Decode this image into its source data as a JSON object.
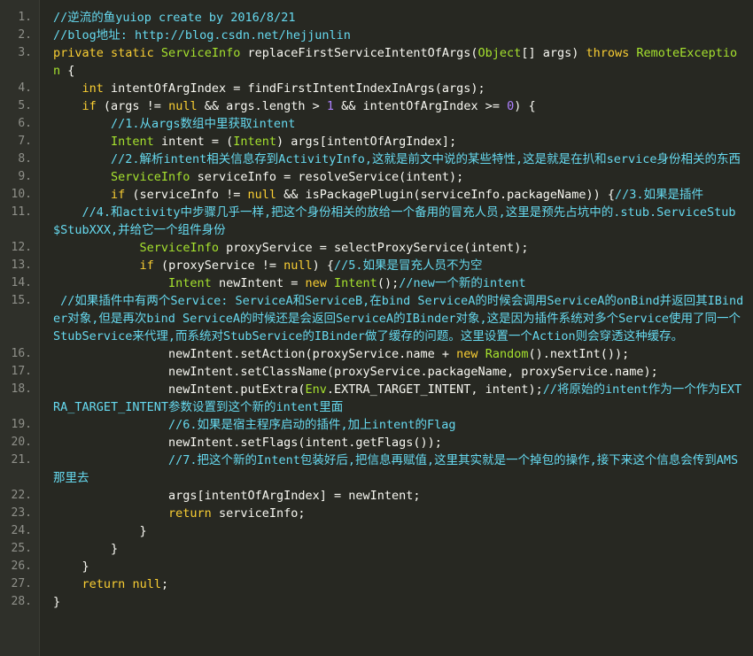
{
  "editor": {
    "lines": [
      {
        "num": "1.",
        "tokens": [
          {
            "t": "//逆流的鱼yuiop create by 2016/8/21",
            "c": "c"
          }
        ]
      },
      {
        "num": "2.",
        "tokens": [
          {
            "t": "//blog地址: http://blog.csdn.net/hejjunlin",
            "c": "c"
          }
        ]
      },
      {
        "num": "3.",
        "tokens": [
          {
            "t": "private static ",
            "c": "k"
          },
          {
            "t": "ServiceInfo",
            "c": "t"
          },
          {
            "t": " replaceFirstServiceIntentOfArgs(",
            "c": "p"
          },
          {
            "t": "Object",
            "c": "t"
          },
          {
            "t": "[] args) ",
            "c": "p"
          },
          {
            "t": "throws ",
            "c": "k"
          },
          {
            "t": "RemoteException",
            "c": "t"
          },
          {
            "t": " {",
            "c": "p"
          }
        ]
      },
      {
        "num": "4.",
        "tokens": [
          {
            "t": "    ",
            "c": "p"
          },
          {
            "t": "int",
            "c": "k"
          },
          {
            "t": " intentOfArgIndex = findFirstIntentIndexInArgs(args);",
            "c": "p"
          }
        ]
      },
      {
        "num": "5.",
        "tokens": [
          {
            "t": "    ",
            "c": "p"
          },
          {
            "t": "if",
            "c": "k"
          },
          {
            "t": " (args != ",
            "c": "p"
          },
          {
            "t": "null",
            "c": "k"
          },
          {
            "t": " && args.length > ",
            "c": "p"
          },
          {
            "t": "1",
            "c": "n"
          },
          {
            "t": " && intentOfArgIndex >= ",
            "c": "p"
          },
          {
            "t": "0",
            "c": "n"
          },
          {
            "t": ") {",
            "c": "p"
          }
        ]
      },
      {
        "num": "6.",
        "tokens": [
          {
            "t": "        ",
            "c": "p"
          },
          {
            "t": "//1.从args数组中里获取intent",
            "c": "c"
          }
        ]
      },
      {
        "num": "7.",
        "tokens": [
          {
            "t": "        ",
            "c": "p"
          },
          {
            "t": "Intent",
            "c": "t"
          },
          {
            "t": " intent = (",
            "c": "p"
          },
          {
            "t": "Intent",
            "c": "t"
          },
          {
            "t": ") args[intentOfArgIndex];",
            "c": "p"
          }
        ]
      },
      {
        "num": "8.",
        "tokens": [
          {
            "t": "        ",
            "c": "p"
          },
          {
            "t": "//2.解析intent相关信息存到ActivityInfo,这就是前文中说的某些特性,这是就是在扒和service身份相关的东西",
            "c": "c"
          }
        ]
      },
      {
        "num": "9.",
        "tokens": [
          {
            "t": "        ",
            "c": "p"
          },
          {
            "t": "ServiceInfo",
            "c": "t"
          },
          {
            "t": " serviceInfo = resolveService(intent);",
            "c": "p"
          }
        ]
      },
      {
        "num": "10.",
        "tokens": [
          {
            "t": "        ",
            "c": "p"
          },
          {
            "t": "if",
            "c": "k"
          },
          {
            "t": " (serviceInfo != ",
            "c": "p"
          },
          {
            "t": "null",
            "c": "k"
          },
          {
            "t": " && isPackagePlugin(serviceInfo.packageName)) {",
            "c": "p"
          },
          {
            "t": "//3.如果是插件",
            "c": "c"
          }
        ]
      },
      {
        "num": "11.",
        "tokens": [
          {
            "t": "    ",
            "c": "p"
          },
          {
            "t": "//4.和activity中步骤几乎一样,把这个身份相关的放给一个备用的冒充人员,这里是预先占坑中的.stub.ServiceStub$StubXXX,并给它一个组件身份",
            "c": "c"
          }
        ]
      },
      {
        "num": "12.",
        "tokens": [
          {
            "t": "            ",
            "c": "p"
          },
          {
            "t": "ServiceInfo",
            "c": "t"
          },
          {
            "t": " proxyService = selectProxyService(intent);",
            "c": "p"
          }
        ]
      },
      {
        "num": "13.",
        "tokens": [
          {
            "t": "            ",
            "c": "p"
          },
          {
            "t": "if",
            "c": "k"
          },
          {
            "t": " (proxyService != ",
            "c": "p"
          },
          {
            "t": "null",
            "c": "k"
          },
          {
            "t": ") {",
            "c": "p"
          },
          {
            "t": "//5.如果是冒充人员不为空",
            "c": "c"
          }
        ]
      },
      {
        "num": "14.",
        "tokens": [
          {
            "t": "                ",
            "c": "p"
          },
          {
            "t": "Intent",
            "c": "t"
          },
          {
            "t": " newIntent = ",
            "c": "p"
          },
          {
            "t": "new",
            "c": "k"
          },
          {
            "t": " ",
            "c": "p"
          },
          {
            "t": "Intent",
            "c": "t"
          },
          {
            "t": "();",
            "c": "p"
          },
          {
            "t": "//new一个新的intent",
            "c": "c"
          }
        ]
      },
      {
        "num": "15.",
        "tokens": [
          {
            "t": " //如果插件中有两个Service: ServiceA和ServiceB,在bind ServiceA的时候会调用ServiceA的onBind并返回其IBinder对象,但是再次bind ServiceA的时候还是会返回ServiceA的IBinder对象,这是因为插件系统对多个Service使用了同一个StubService来代理,而系统对StubService的IBinder做了缓存的问题。这里设置一个Action则会穿透这种缓存。",
            "c": "c"
          }
        ]
      },
      {
        "num": "16.",
        "tokens": [
          {
            "t": "                ",
            "c": "p"
          },
          {
            "t": "newIntent.setAction(proxyService.name + ",
            "c": "p"
          },
          {
            "t": "new",
            "c": "k"
          },
          {
            "t": " ",
            "c": "p"
          },
          {
            "t": "Random",
            "c": "t"
          },
          {
            "t": "().nextInt());",
            "c": "p"
          }
        ]
      },
      {
        "num": "17.",
        "tokens": [
          {
            "t": "                ",
            "c": "p"
          },
          {
            "t": "newIntent.setClassName(proxyService.packageName, proxyService.name);",
            "c": "p"
          }
        ]
      },
      {
        "num": "18.",
        "tokens": [
          {
            "t": "                ",
            "c": "p"
          },
          {
            "t": "newIntent.putExtra(",
            "c": "p"
          },
          {
            "t": "Env",
            "c": "t"
          },
          {
            "t": ".EXTRA_TARGET_INTENT, intent);",
            "c": "p"
          },
          {
            "t": "//将原始的intent作为一个作为EXTRA_TARGET_INTENT参数设置到这个新的intent里面",
            "c": "c"
          }
        ]
      },
      {
        "num": "19.",
        "tokens": [
          {
            "t": "                ",
            "c": "p"
          },
          {
            "t": "//6.如果是宿主程序启动的插件,加上intent的Flag",
            "c": "c"
          }
        ]
      },
      {
        "num": "20.",
        "tokens": [
          {
            "t": "                ",
            "c": "p"
          },
          {
            "t": "newIntent.setFlags(intent.getFlags());",
            "c": "p"
          }
        ]
      },
      {
        "num": "21.",
        "tokens": [
          {
            "t": "                ",
            "c": "p"
          },
          {
            "t": "//7.把这个新的Intent包装好后,把信息再赋值,这里其实就是一个掉包的操作,接下来这个信息会传到AMS那里去",
            "c": "c"
          }
        ]
      },
      {
        "num": "22.",
        "tokens": [
          {
            "t": "                ",
            "c": "p"
          },
          {
            "t": "args[intentOfArgIndex] = newIntent;",
            "c": "p"
          }
        ]
      },
      {
        "num": "23.",
        "tokens": [
          {
            "t": "                ",
            "c": "p"
          },
          {
            "t": "return",
            "c": "k"
          },
          {
            "t": " serviceInfo;",
            "c": "p"
          }
        ]
      },
      {
        "num": "24.",
        "tokens": [
          {
            "t": "            }",
            "c": "p"
          }
        ]
      },
      {
        "num": "25.",
        "tokens": [
          {
            "t": "        }",
            "c": "p"
          }
        ]
      },
      {
        "num": "26.",
        "tokens": [
          {
            "t": "    }",
            "c": "p"
          }
        ]
      },
      {
        "num": "27.",
        "tokens": [
          {
            "t": "    ",
            "c": "p"
          },
          {
            "t": "return",
            "c": "k"
          },
          {
            "t": " ",
            "c": "p"
          },
          {
            "t": "null",
            "c": "k"
          },
          {
            "t": ";",
            "c": "p"
          }
        ]
      },
      {
        "num": "28.",
        "tokens": [
          {
            "t": "}",
            "c": "p"
          }
        ]
      }
    ]
  }
}
